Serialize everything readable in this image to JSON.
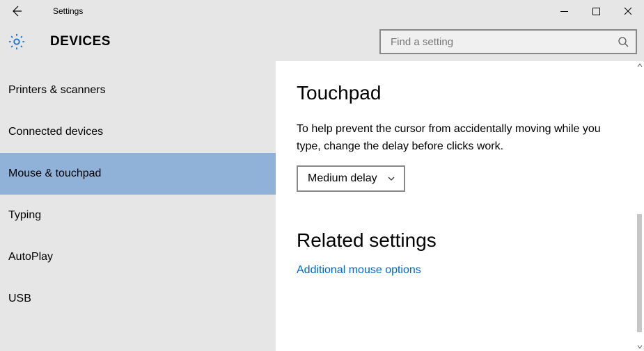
{
  "titlebar": {
    "title": "Settings"
  },
  "header": {
    "category": "DEVICES",
    "search_placeholder": "Find a setting"
  },
  "sidebar": {
    "items": [
      {
        "label": "Printers & scanners",
        "selected": false
      },
      {
        "label": "Connected devices",
        "selected": false
      },
      {
        "label": "Mouse & touchpad",
        "selected": true
      },
      {
        "label": "Typing",
        "selected": false
      },
      {
        "label": "AutoPlay",
        "selected": false
      },
      {
        "label": "USB",
        "selected": false
      }
    ]
  },
  "content": {
    "section_title": "Touchpad",
    "description": "To help prevent the cursor from accidentally moving while you type, change the delay before clicks work.",
    "delay_dropdown": {
      "selected": "Medium delay"
    },
    "related_title": "Related settings",
    "related_link": "Additional mouse options"
  }
}
